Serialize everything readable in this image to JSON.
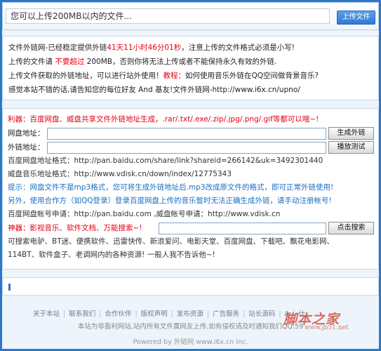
{
  "upload": {
    "placeholder": "您可以上传200MB以内的文件...",
    "button_label": "上传文件"
  },
  "info": {
    "line1": {
      "a": "文件外链网-已经稳定提供外链",
      "b": "41天11小时46分01秒",
      "c": "，注意上传的文件格式必须是小写!"
    },
    "line2": {
      "a": "上传的文件请 ",
      "b": "不要超过",
      "c": " 200MB，否则你将无法上传或者不能保持永久有效的外链."
    },
    "line3": {
      "a": "上传文件获取的外链地址，可以进行站外使用！",
      "b": "教程：",
      "c": "如何使用音乐外链在QQ空间做背景音乐?"
    },
    "line4": {
      "a": "感觉本站不错的话,请告知您的每位好友  And 基友!文件外链网-http://www.i6x.cn/upno/"
    }
  },
  "tools": {
    "tip1": {
      "a": "利器：",
      "b": "百度网盘、威盘共享文件外链地址生成，.rar/.txt/.exe/.zip/.jpg/.png/.gif等都可以哦~!"
    },
    "netdisk_label": "网盘地址：",
    "generate_button": "生成外链",
    "external_label": "外链地址：",
    "test_button": "播放测试",
    "baidu_format": "百度网盘地址格式：http://pan.baidu.com/share/link?shareid=266142&uk=3492301440",
    "vdisk_format": "威盘音乐地址格式：http://www.vdisk.cn/down/index/12775343",
    "tip2": "提示：网盘文件不是mp3格式，您可将生成外链地址后.mp3改成原文件的格式，即可正常外链使用!",
    "tip3": "另外，使用合作方（如QQ登录）登录百度网盘上传的音乐暂时无法正确生成外链，请手动注册帐号!",
    "account_apply": "百度网盘帐号申请：http://pan.baidu.com ,威盘帐号申请：http://www.vdisk.cn",
    "search_label": "神器：影视音乐、软件文档、万能搜索~!",
    "search_button": "点击搜索",
    "search_desc1": "可搜索电驴、BT迷、便携软件、迅雷快传、新浪爱问、电影天堂、百度网盘、下载吧、飘花电影网、",
    "search_desc2": "114BT、软件盒子、老调网内的各种资源!  一般人我不告诉他~!"
  },
  "footer": {
    "links": [
      "关于本站",
      "联系我们",
      "合作伙伴",
      "版权声明",
      "发布资源",
      "广告服务",
      "站长源码",
      "A",
      "计"
    ],
    "note": "本站为非盈利网站,站内所有文件属网友上传,如有侵权请及时通知我们QQ:59",
    "powered": "Powered by 外链网 www.i6x.cn Inc."
  },
  "watermark": {
    "text": "脚本之家",
    "url": "www.jb51.net"
  },
  "colors": {
    "background": "#2a78c9",
    "panel": "#eef4fb",
    "accent_red": "#e60012",
    "accent_blue": "#1a6fc4",
    "accent_green": "#1f8f3a",
    "button_blue": "#2f7ad4"
  }
}
